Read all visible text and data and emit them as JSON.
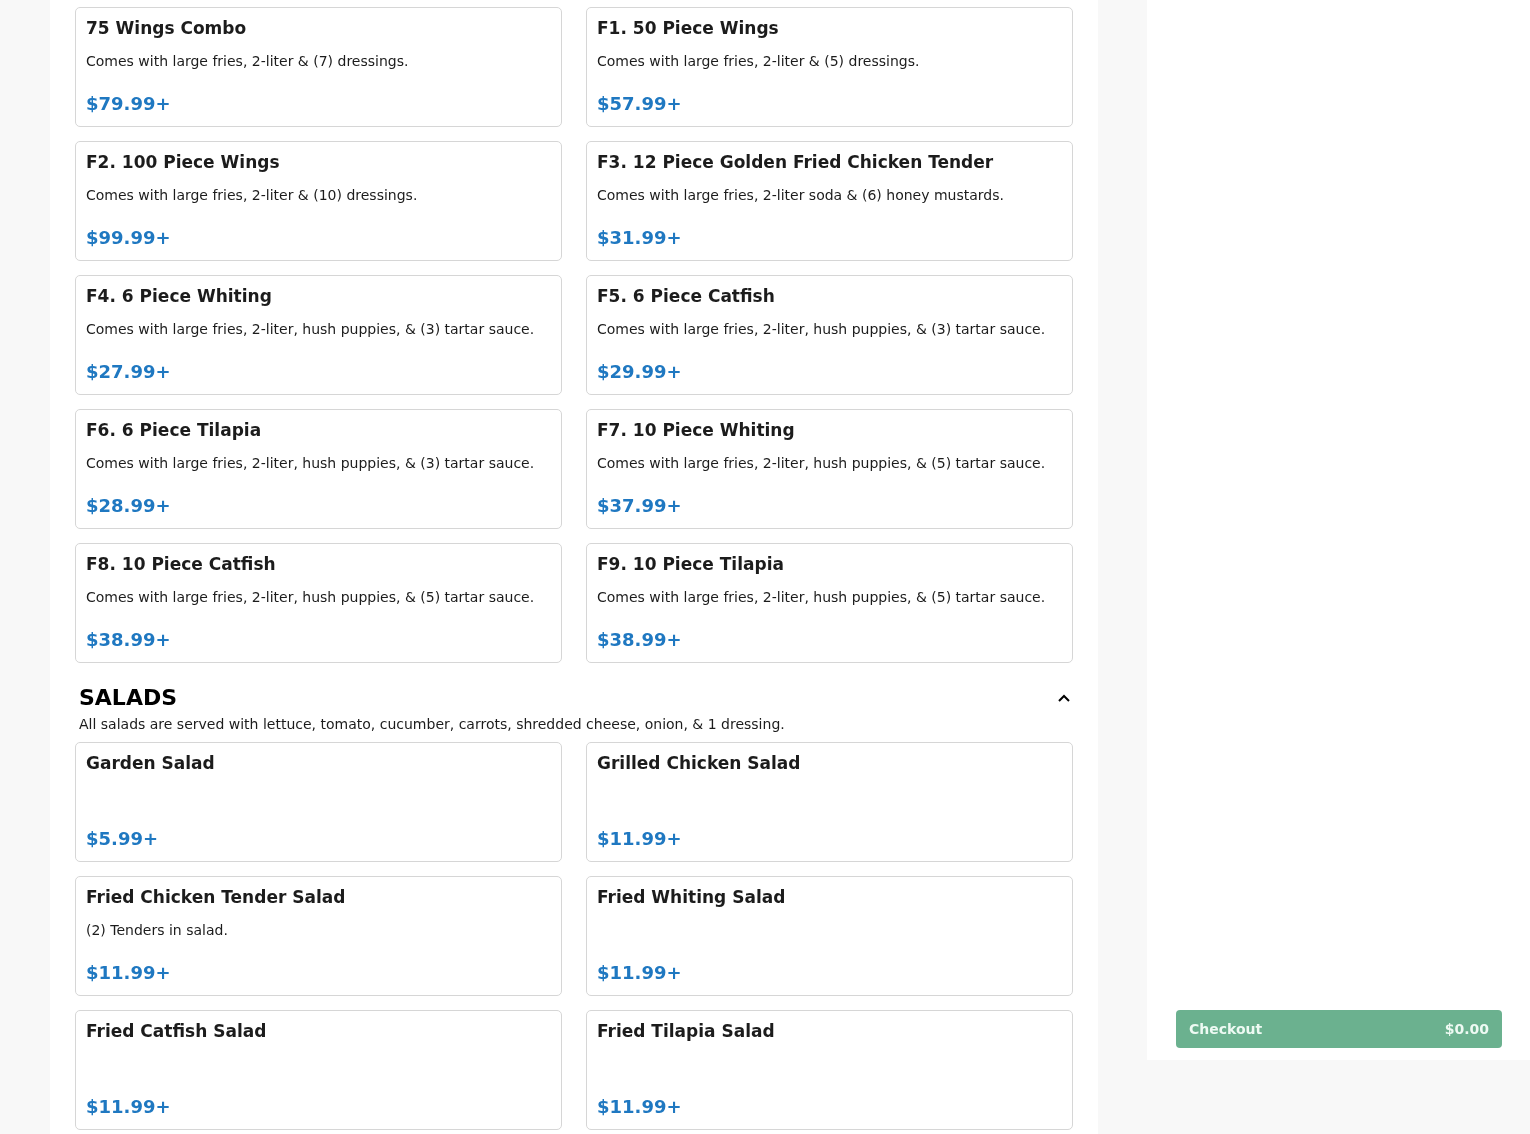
{
  "sections": [
    {
      "items": [
        {
          "name": "75 Wings Combo",
          "description": "Comes with large fries, 2-liter & (7) dressings.",
          "price": "$79.99+"
        },
        {
          "name": "F1. 50 Piece Wings",
          "description": "Comes with large fries, 2-liter & (5) dressings.",
          "price": "$57.99+"
        },
        {
          "name": "F2. 100 Piece Wings",
          "description": "Comes with large fries, 2-liter & (10) dressings.",
          "price": "$99.99+"
        },
        {
          "name": "F3. 12 Piece Golden Fried Chicken Tender",
          "description": "Comes with large fries, 2-liter soda & (6) honey mustards.",
          "price": "$31.99+"
        },
        {
          "name": "F4. 6 Piece Whiting",
          "description": "Comes with large fries, 2-liter, hush puppies, & (3) tartar sauce.",
          "price": "$27.99+"
        },
        {
          "name": "F5. 6 Piece Catfish",
          "description": "Comes with large fries, 2-liter, hush puppies, & (3) tartar sauce.",
          "price": "$29.99+"
        },
        {
          "name": "F6. 6 Piece Tilapia",
          "description": "Comes with large fries, 2-liter, hush puppies, & (3) tartar sauce.",
          "price": "$28.99+"
        },
        {
          "name": "F7. 10 Piece Whiting",
          "description": "Comes with large fries, 2-liter, hush puppies, & (5) tartar sauce.",
          "price": "$37.99+"
        },
        {
          "name": "F8. 10 Piece Catfish",
          "description": "Comes with large fries, 2-liter, hush puppies, & (5) tartar sauce.",
          "price": "$38.99+"
        },
        {
          "name": "F9. 10 Piece Tilapia",
          "description": "Comes with large fries, 2-liter, hush puppies, & (5) tartar sauce.",
          "price": "$38.99+"
        }
      ]
    },
    {
      "title": "SALADS",
      "expanded": true,
      "description": "All salads are served with lettuce, tomato, cucumber, carrots, shredded cheese, onion, & 1 dressing.",
      "items": [
        {
          "name": "Garden Salad",
          "price": "$5.99+"
        },
        {
          "name": "Grilled Chicken Salad",
          "price": "$11.99+"
        },
        {
          "name": "Fried Chicken Tender Salad",
          "description": "(2) Tenders in salad.",
          "price": "$11.99+"
        },
        {
          "name": "Fried Whiting Salad",
          "price": "$11.99+"
        },
        {
          "name": "Fried Catfish Salad",
          "price": "$11.99+"
        },
        {
          "name": "Fried Tilapia Salad",
          "price": "$11.99+"
        }
      ]
    }
  ],
  "checkout": {
    "label": "Checkout",
    "total": "$0.00"
  }
}
